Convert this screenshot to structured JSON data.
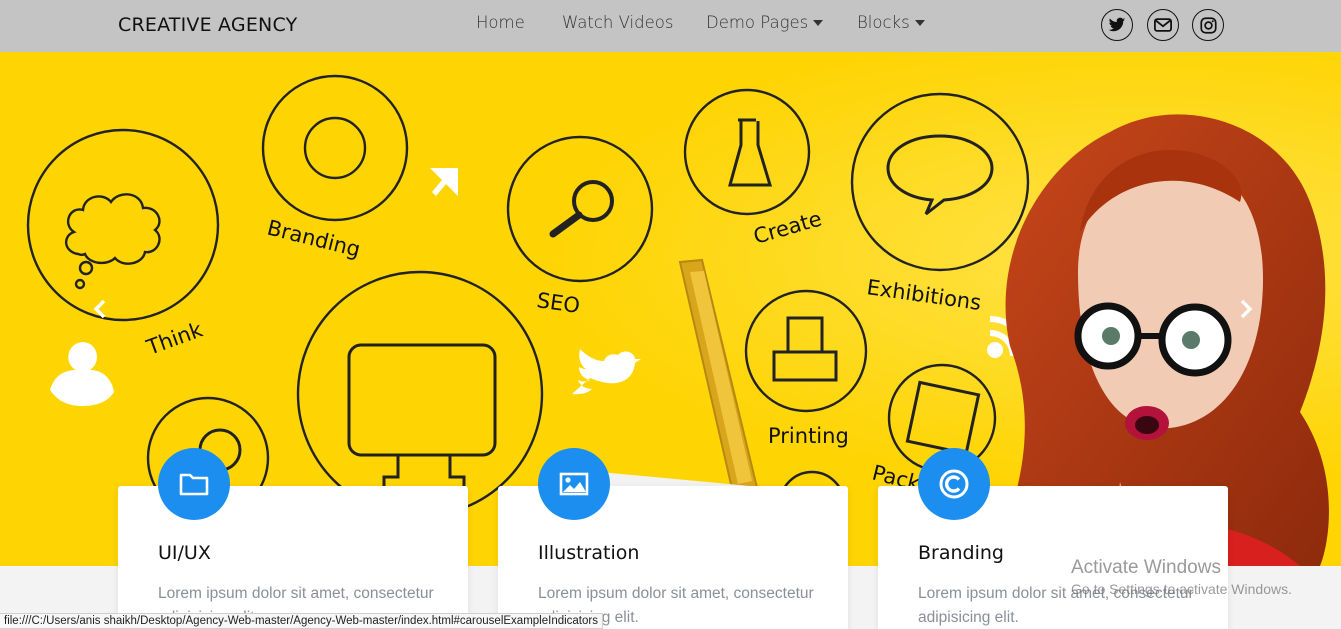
{
  "nav": {
    "brand": "CREATIVE AGENCY",
    "links": [
      "Home",
      "Watch Videos",
      "Demo Pages",
      "Blocks"
    ],
    "social_icons": [
      "twitter-icon",
      "envelope-icon",
      "instagram-icon"
    ]
  },
  "hero": {
    "labels": [
      "Think",
      "Branding",
      "SEO",
      "Create",
      "Exhibitions",
      "Printing",
      "Pack"
    ],
    "controls": [
      "chevron-left-icon",
      "chevron-right-icon"
    ],
    "colors": {
      "background": "#fed402",
      "hair": "#b83a12",
      "line_art": "#222222"
    }
  },
  "cards": [
    {
      "icon": "folder-icon",
      "title": "UI/UX",
      "text": "Lorem ipsum dolor sit amet, consectetur adipisicing elit."
    },
    {
      "icon": "image-icon",
      "title": "Illustration",
      "text": "Lorem ipsum dolor sit amet, consectetur adipisicing elit."
    },
    {
      "icon": "copyright-icon",
      "title": "Branding",
      "text": "Lorem ipsum dolor sit amet, consectetur adipisicing elit."
    }
  ],
  "accent_color": "#1b8ef0",
  "statusbar": "file:///C:/Users/anis shaikh/Desktop/Agency-Web-master/Agency-Web-master/index.html#carouselExampleIndicators",
  "watermark": {
    "title": "Activate Windows",
    "subtitle": "Go to Settings to activate Windows."
  }
}
